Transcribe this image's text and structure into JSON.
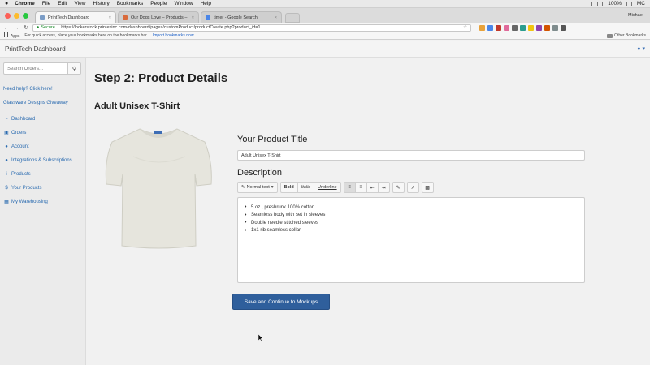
{
  "menubar": {
    "items": [
      "Chrome",
      "File",
      "Edit",
      "View",
      "History",
      "Bookmarks",
      "People",
      "Window",
      "Help"
    ],
    "right_text": "100%",
    "user_initials": "MC"
  },
  "browser": {
    "tabs": [
      {
        "label": "PrintTech Dashboard"
      },
      {
        "label": "Our Dogs Love – Products –"
      },
      {
        "label": "timer - Google Search"
      }
    ],
    "profile_name": "Michael",
    "secure_label": "Secure",
    "url": "https://lockerstock.printexinc.com/dashboard/pages/customProduct/productCreate.php?product_id=1",
    "bookmarks": {
      "apps_label": "Apps",
      "hint": "For quick access, place your bookmarks here on the bookmarks bar.",
      "import_link": "Import bookmarks now...",
      "other": "Other Bookmarks"
    }
  },
  "header": {
    "brand": "PrintTech Dashboard"
  },
  "sidebar": {
    "search_placeholder": "Search Orders...",
    "links": [
      "Need help? Click here!",
      "Glassware Designs Giveaway"
    ],
    "items": [
      {
        "label": "Dashboard",
        "icon": "dashboard-icon"
      },
      {
        "label": "Orders",
        "icon": "cart-icon"
      },
      {
        "label": "Account",
        "icon": "user-icon"
      },
      {
        "label": "Integrations & Subscriptions",
        "icon": "user-icon"
      },
      {
        "label": "Products",
        "icon": "info-icon"
      },
      {
        "label": "Your Products",
        "icon": "dollar-icon"
      },
      {
        "label": "My Warehousing",
        "icon": "warehouse-icon"
      }
    ]
  },
  "main": {
    "step_title": "Step 2: Product Details",
    "product_name": "Adult Unisex T-Shirt",
    "title_label": "Your Product Title",
    "title_value": "Adult Unisex T-Shirt",
    "description_label": "Description",
    "toolbar": {
      "format": "Normal text",
      "bold": "Bold",
      "italic": "Italic",
      "underline": "Underline"
    },
    "description_items": [
      "5 oz., preshrunk 100% cotton",
      "Seamless body with set in sleeves",
      "Double needle stitched sleeves",
      "1x1 rib seamless collar"
    ],
    "save_button": "Save and Continue to Mockups"
  },
  "colors": {
    "primary_button": "#2f5f9c",
    "link": "#2a6bb0",
    "shirt": "#e6e5dd"
  }
}
